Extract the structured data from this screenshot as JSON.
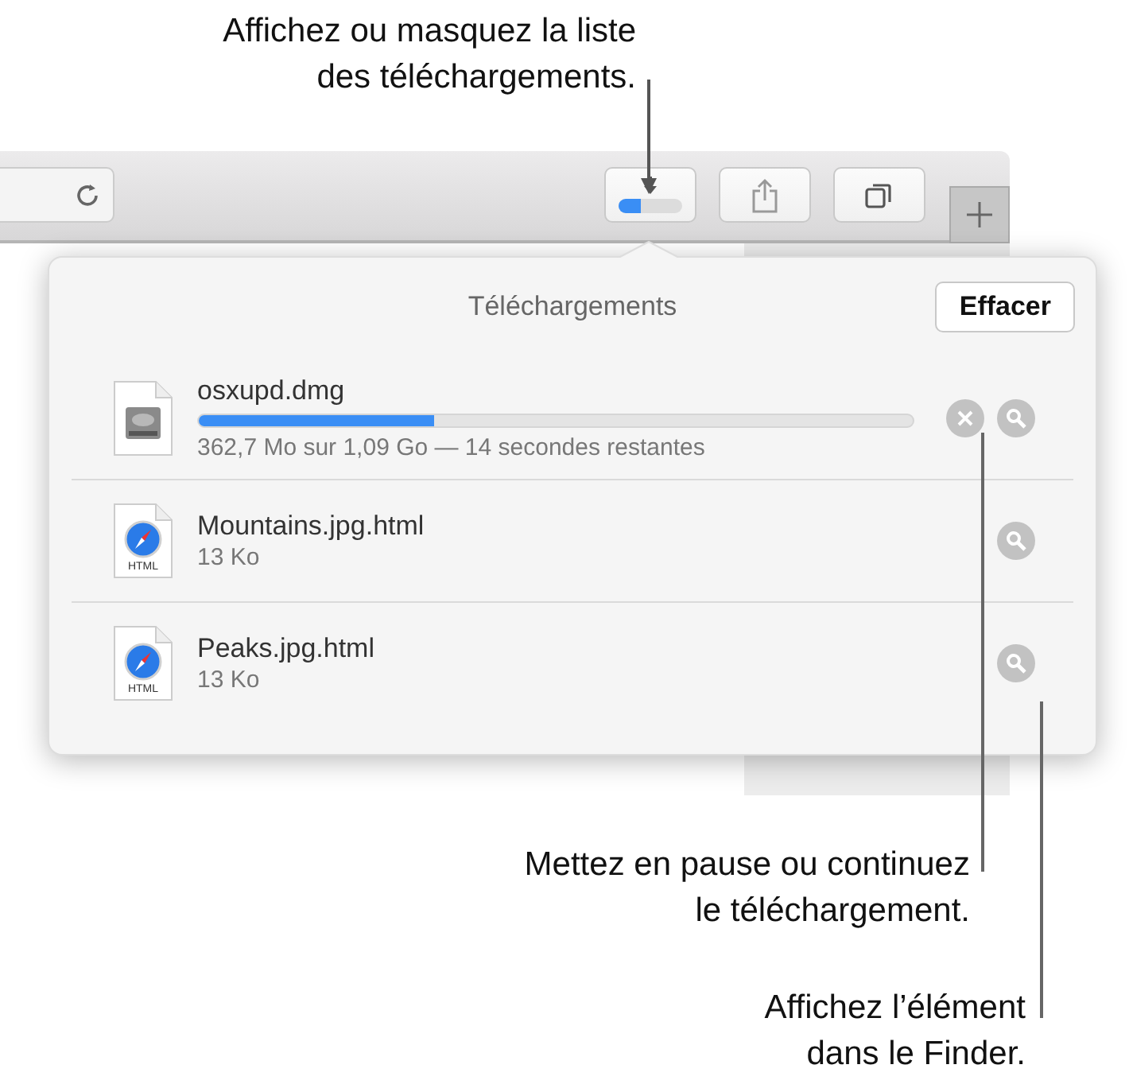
{
  "callouts": [
    {
      "lines": [
        "Affichez ou masquez la liste",
        "des téléchargements."
      ]
    },
    {
      "lines": [
        "Mettez en pause ou continuez",
        "le téléchargement."
      ]
    },
    {
      "lines": [
        "Affichez l’élément",
        "dans le Finder."
      ]
    }
  ],
  "toolbar": {
    "download_button": {
      "level": 0.35
    },
    "buttons": [
      {
        "kind": "share"
      },
      {
        "kind": "tabs"
      }
    ]
  },
  "popover": {
    "title": "Téléchargements",
    "clear_button": "Effacer",
    "items": [
      {
        "kind": "disk-image",
        "name": "osxupd.dmg",
        "in_progress": true,
        "level": 0.33,
        "detail": "362,7 Mo sur 1,09 Go — 14 secondes restantes"
      },
      {
        "kind": "html",
        "icon_label": "HTML",
        "name": "Mountains.jpg.html",
        "in_progress": false,
        "detail": "13 Ko"
      },
      {
        "kind": "html",
        "icon_label": "HTML",
        "name": "Peaks.jpg.html",
        "in_progress": false,
        "detail": "13 Ko"
      }
    ]
  }
}
